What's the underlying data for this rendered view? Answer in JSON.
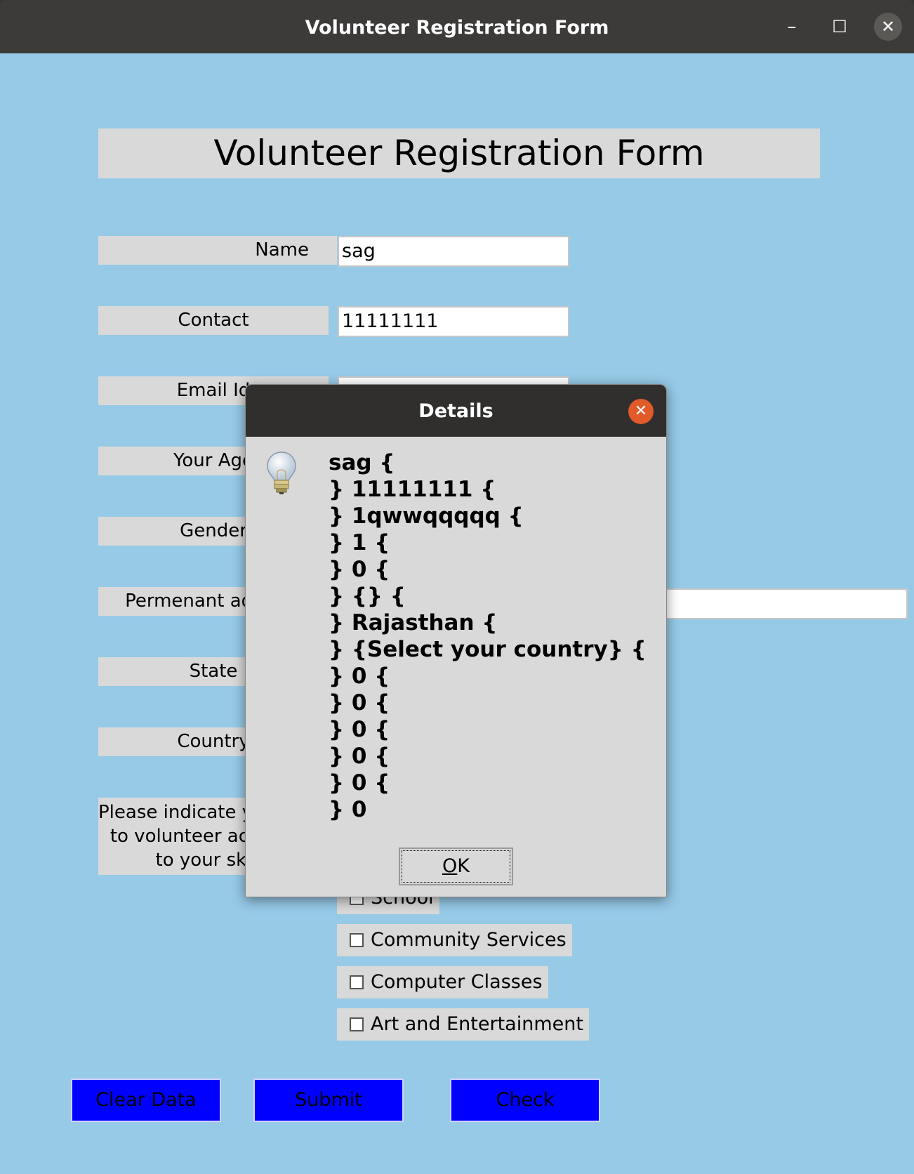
{
  "window": {
    "title": "Volunteer Registration Form",
    "minimize_glyph": "–",
    "maximize_glyph": "☐",
    "close_glyph": "✕"
  },
  "form": {
    "heading": "Volunteer Registration Form",
    "labels": {
      "name": "Name",
      "contact": "Contact",
      "email": "Email Id",
      "age": "Your Age",
      "gender": "Gender",
      "address": "Permenant address",
      "state": "State",
      "country": "Country",
      "interest_lines": [
        "Please indicate your interest",
        "to volunteer according",
        "to your skills"
      ]
    },
    "values": {
      "name": "sag",
      "contact": "11111111",
      "email": "",
      "address": ""
    },
    "checkboxes": [
      {
        "label": "School",
        "checked": false
      },
      {
        "label": "Community Services",
        "checked": false
      },
      {
        "label": "Computer Classes",
        "checked": false
      },
      {
        "label": "Art and Entertainment",
        "checked": false
      }
    ],
    "buttons": {
      "clear": "Clear Data",
      "submit": "Submit",
      "check": "Check"
    }
  },
  "dialog": {
    "title": "Details",
    "close_glyph": "✕",
    "message_lines": [
      "sag {",
      "} 11111111 {",
      "} 1qwwqqqqq {",
      "} 1 {",
      "} 0 {",
      "} {} {",
      "} Rajasthan {",
      "} {Select your country} {",
      "} 0 {",
      "} 0 {",
      "} 0 {",
      "} 0 {",
      "} 0 {",
      "} 0"
    ],
    "ok_mnemonic": "O",
    "ok_rest": "K"
  },
  "colors": {
    "background": "#96cae7",
    "label_bg": "#d9d9d9",
    "button_blue": "#0000ff",
    "dialog_close": "#e05a2a"
  }
}
